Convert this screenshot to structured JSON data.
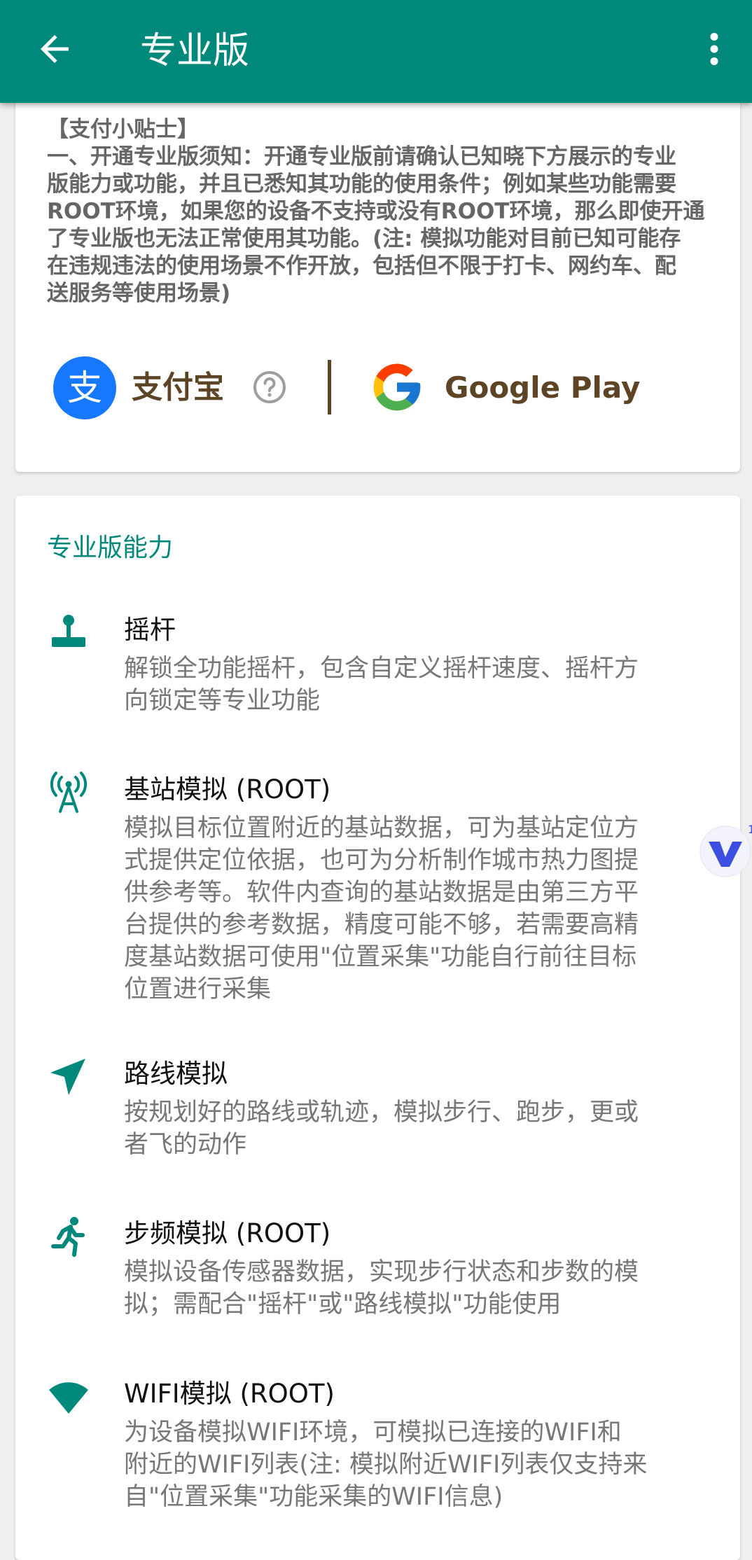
{
  "appbar": {
    "title": "专业版",
    "back_icon": "arrow-back-icon",
    "more_icon": "more-vert-icon"
  },
  "tips": {
    "lines": [
      "【支付小贴士】",
      "一、开通专业版须知：开通专业版前请确认已知晓下方展示的专业",
      "版能力或功能，并且已悉知其功能的使用条件；例如某些功能需要",
      "ROOT环境，如果您的设备不支持或没有ROOT环境，那么即使开通",
      "了专业版也无法正常使用其功能。(注: 模拟功能对目前已知可能存",
      "在违规违法的使用场景不作开放，包括但不限于打卡、网约车、配",
      "送服务等使用场景)"
    ]
  },
  "payment": {
    "alipay_label": "支付宝",
    "alipay_logo_char": "支",
    "google_label": "Google Play",
    "help_icon": "help-circle-icon"
  },
  "capabilities": {
    "section_title": "专业版能力",
    "items": [
      {
        "icon": "joystick-icon",
        "name": "摇杆",
        "desc_lines": [
          "解锁全功能摇杆，包含自定义摇杆速度、摇杆方",
          "向锁定等专业功能"
        ]
      },
      {
        "icon": "cell-tower-icon",
        "name": "基站模拟 (ROOT)",
        "desc_lines": [
          "模拟目标位置附近的基站数据，可为基站定位方",
          "式提供定位依据，也可为分析制作城市热力图提",
          "供参考等。软件内查询的基站数据是由第三方平",
          "台提供的参考数据，精度可能不够，若需要高精",
          "度基站数据可使用\"位置采集\"功能自行前往目标",
          "位置进行采集"
        ]
      },
      {
        "icon": "navigation-arrow-icon",
        "name": "路线模拟",
        "desc_lines": [
          "按规划好的路线或轨迹，模拟步行、跑步，更或",
          "者飞的动作"
        ]
      },
      {
        "icon": "running-person-icon",
        "name": "步频模拟 (ROOT)",
        "desc_lines": [
          "模拟设备传感器数据，实现步行状态和步数的模",
          "拟；需配合\"摇杆\"或\"路线模拟\"功能使用"
        ]
      },
      {
        "icon": "wifi-icon",
        "name": "WIFI模拟 (ROOT)",
        "desc_lines": [
          "为设备模拟WIFI环境，可模拟已连接的WIFI和",
          "附近的WIFI列表(注: 模拟附近WIFI列表仅支持来",
          "自\"位置采集\"功能采集的WIFI信息)"
        ]
      }
    ]
  },
  "floating_button": {
    "icon": "v-logo-icon",
    "badge": "1"
  },
  "colors": {
    "primary": "#00897b",
    "brown": "#5d4425",
    "alipay_blue": "#1677ff"
  }
}
